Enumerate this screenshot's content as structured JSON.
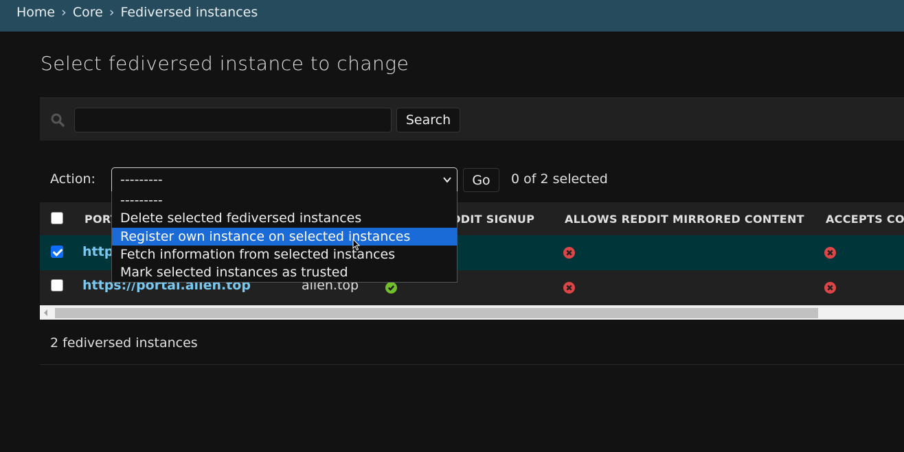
{
  "breadcrumbs": {
    "items": [
      "Home",
      "Core",
      "Fediversed instances"
    ],
    "separator": "›"
  },
  "page": {
    "title": "Select fediversed instance to change"
  },
  "search": {
    "value": "",
    "placeholder": "",
    "button_label": "Search"
  },
  "actions": {
    "label": "Action:",
    "selected": "---------",
    "go_label": "Go",
    "counter": "0 of 2 selected",
    "options": [
      "---------",
      "Delete selected fediversed instances",
      "Register own instance on selected instances",
      "Fetch information from selected instances",
      "Mark selected instances as trusted"
    ],
    "highlighted_index": 2
  },
  "table": {
    "columns": [
      "PORTAL",
      "",
      "ALLOWS REDDIT SIGNUP",
      "ALLOWS REDDIT MIRRORED CONTENT",
      "ACCEPTS CO"
    ],
    "header_visible": {
      "portal": "PORT",
      "signup": "EDDIT SIGNUP",
      "mirrored": "ALLOWS REDDIT MIRRORED CONTENT",
      "accepts": "ACCEPTS CO"
    },
    "rows": [
      {
        "checked": true,
        "portal_visible": "http",
        "domain": "",
        "signup": "hidden",
        "mirrored": "no",
        "accepts": "no"
      },
      {
        "checked": false,
        "portal_visible": "https://portal.alien.top",
        "domain": "alien.top",
        "signup": "yes",
        "mirrored": "no",
        "accepts": "no"
      }
    ]
  },
  "footer": {
    "count": "2 fediversed instances"
  },
  "colors": {
    "header_bg": "#264b5d",
    "selected_row": "#00363a",
    "link": "#79c8f0",
    "highlight": "#1a6ad8",
    "yes": "#70bf2b",
    "no": "#dd4646"
  }
}
